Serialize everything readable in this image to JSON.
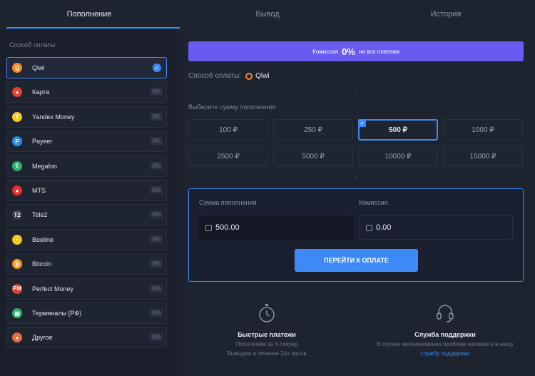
{
  "tabs": [
    "Пополнение",
    "Вывод",
    "История"
  ],
  "left": {
    "title": "Способ оплаты",
    "methods": [
      {
        "label": "Qiwi",
        "badge": "",
        "color": "#f58a1f",
        "glyph": "Q"
      },
      {
        "label": "Карта",
        "badge": "0%",
        "color": "#e8402f",
        "glyph": "●"
      },
      {
        "label": "Yandex Money",
        "badge": "0%",
        "color": "#f3c81b",
        "glyph": "¥"
      },
      {
        "label": "Payeer",
        "badge": "0%",
        "color": "#2a8fe0",
        "glyph": "P"
      },
      {
        "label": "Megafon",
        "badge": "0%",
        "color": "#2bb36b",
        "glyph": "€"
      },
      {
        "label": "MTS",
        "badge": "0%",
        "color": "#e8302a",
        "glyph": "●"
      },
      {
        "label": "Tele2",
        "badge": "0%",
        "color": "#3a3f4d",
        "glyph": "T2"
      },
      {
        "label": "Beeline",
        "badge": "0%",
        "color": "#f3c81b",
        "glyph": "≡"
      },
      {
        "label": "Bitcoin",
        "badge": "0%",
        "color": "#f59a23",
        "glyph": "₿"
      },
      {
        "label": "Perfect Money",
        "badge": "0%",
        "color": "#e8402f",
        "glyph": "PM"
      },
      {
        "label": "Терминалы (РФ)",
        "badge": "0%",
        "color": "#2bb36b",
        "glyph": "▤"
      },
      {
        "label": "Другое",
        "badge": "0%",
        "color": "#e86a3a",
        "glyph": "●"
      }
    ]
  },
  "banner": {
    "pre": "Комиссия",
    "value": "0%",
    "post": "на все платежи"
  },
  "pay_method": {
    "label": "Способ оплаты:",
    "value": "Qiwi"
  },
  "sum_title": "Выберите сумму пополнения",
  "amounts": [
    "100 ₽",
    "250 ₽",
    "500 ₽",
    "1000 ₽",
    "2500 ₽",
    "5000 ₽",
    "10000 ₽",
    "15000 ₽"
  ],
  "summary": {
    "amount_label": "Сумма пополнения",
    "amount_value": "500.00",
    "fee_label": "Комиссия",
    "fee_value": "0.00",
    "button": "ПЕРЕЙТИ К ОПЛАТЕ"
  },
  "features": {
    "fast": {
      "title": "Быстрые платежи",
      "line1": "Пополняем за 5 секунд",
      "line2": "Выводим в течение 24х часов"
    },
    "support": {
      "title": "Служба поддержки",
      "line1": "В случае возникновения проблем напишите в нашу",
      "link": "службу поддержки"
    }
  }
}
